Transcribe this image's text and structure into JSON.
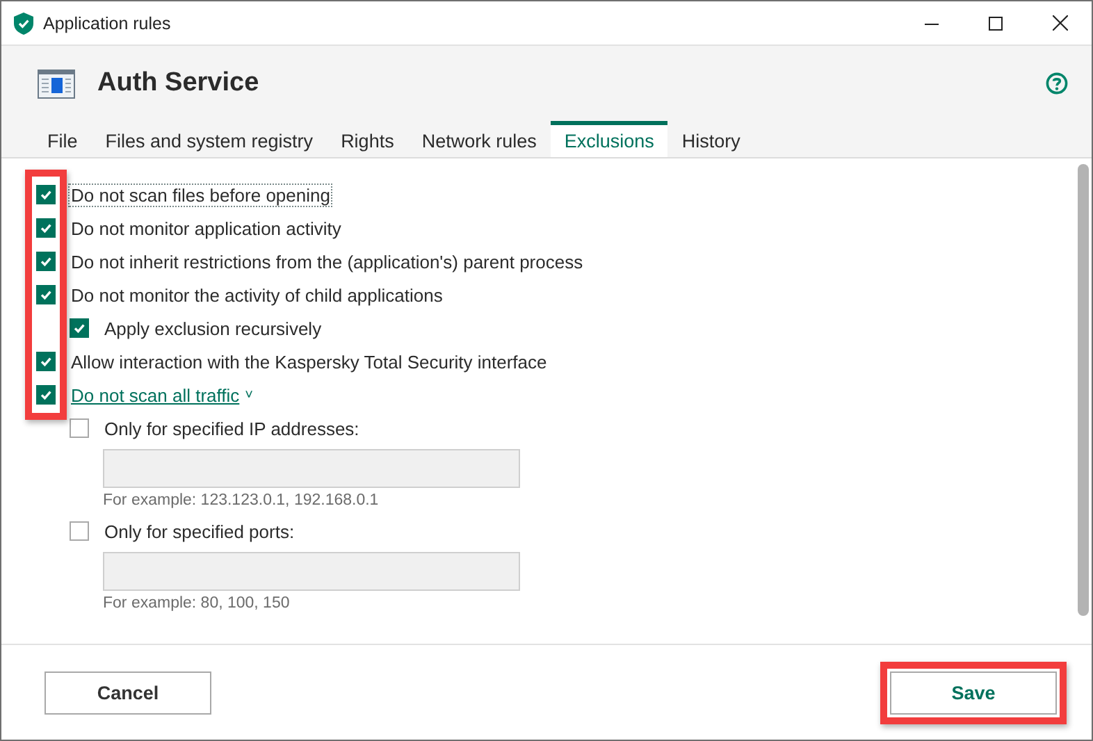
{
  "window": {
    "title": "Application rules"
  },
  "app": {
    "name": "Auth Service"
  },
  "tabs": [
    {
      "label": "File",
      "selected": false
    },
    {
      "label": "Files and system registry",
      "selected": false
    },
    {
      "label": "Rights",
      "selected": false
    },
    {
      "label": "Network rules",
      "selected": false
    },
    {
      "label": "Exclusions",
      "selected": true
    },
    {
      "label": "History",
      "selected": false
    }
  ],
  "exclusions": {
    "checkboxes_highlighted": true,
    "options": [
      {
        "kind": "check",
        "label": "Do not scan files before opening",
        "checked": true,
        "focused": true
      },
      {
        "kind": "check",
        "label": "Do not monitor application activity",
        "checked": true,
        "focused": false
      },
      {
        "kind": "check",
        "label": "Do not inherit restrictions from the (application's) parent process",
        "checked": true,
        "focused": false
      },
      {
        "kind": "check",
        "label": "Do not monitor the activity of child applications",
        "checked": true,
        "focused": false,
        "children": [
          {
            "kind": "check",
            "label": "Apply exclusion recursively",
            "checked": true,
            "focused": false
          }
        ]
      },
      {
        "kind": "check",
        "label": "Allow interaction with the Kaspersky Total Security interface",
        "checked": true,
        "focused": false
      },
      {
        "kind": "expander",
        "label": "Do not scan all traffic",
        "caret": "˅",
        "checked": true,
        "focused": false,
        "children": [
          {
            "kind": "field",
            "label": "Only for specified IP addresses:",
            "checked": false,
            "hint": "For example: 123.123.0.1, 192.168.0.1"
          },
          {
            "kind": "field",
            "label": "Only for specified ports:",
            "checked": false,
            "hint": "For example: 80, 100, 150"
          }
        ]
      }
    ]
  },
  "buttons": [
    {
      "label": "Cancel",
      "kind": "secondary",
      "highlighted": false
    },
    {
      "label": "Save",
      "kind": "primary",
      "highlighted": true
    }
  ]
}
